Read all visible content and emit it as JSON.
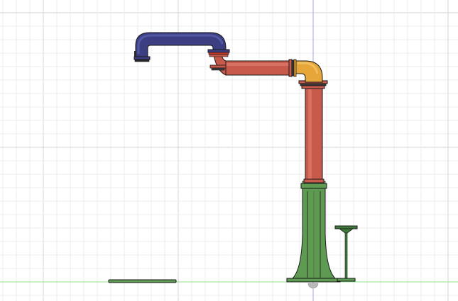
{
  "viewport": {
    "background": "#ffffff",
    "grid_minor_color": "#ececec",
    "grid_major_color": "#d6d6d6",
    "vertical_axis_color": "#a6a6e6",
    "ground_axis_color": "#8fe08f"
  },
  "colors": {
    "blue_pipe": "#3b3f82",
    "blue_pipe_light": "#5a5fae",
    "red_pipe": "#c85a4c",
    "red_pipe_light": "#dc7a6c",
    "orange_elbow": "#e6a63a",
    "orange_elbow_light": "#f2c466",
    "green_base": "#5f9a52",
    "green_base_light": "#7cb56c",
    "outline": "#1a1a1a",
    "stand": "#3f7a3a",
    "origin_marker": "#b8b8b8"
  },
  "objects": {
    "blue_section": "blue-pipe-section",
    "red_horizontal": "red-horizontal-pipe",
    "orange_elbow": "orange-elbow",
    "red_vertical": "red-vertical-pipe",
    "green_pedestal": "green-pedestal",
    "side_stand": "side-stand",
    "ground_bar": "ground-bar",
    "origin_marker": "origin-marker"
  }
}
